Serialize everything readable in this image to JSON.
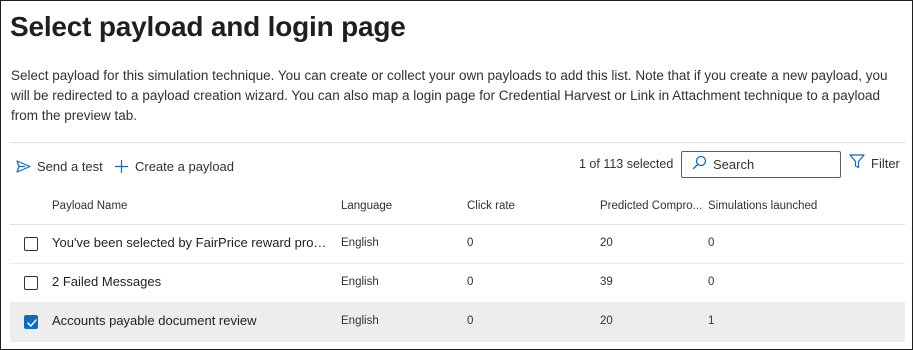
{
  "page": {
    "title": "Select payload and login page",
    "description": "Select payload for this simulation technique. You can create or collect your own payloads to add this list. Note that if you create a new payload, you will be redirected to a payload creation wizard. You can also map a login page for Credential Harvest or Link in Attachment technique to a payload from the preview tab."
  },
  "toolbar": {
    "send_test_label": "Send a test",
    "create_payload_label": "Create a payload",
    "selection_count": "1 of 113 selected",
    "search_placeholder": "Search",
    "search_value": "",
    "filter_label": "Filter"
  },
  "table": {
    "columns": {
      "name": "Payload Name",
      "language": "Language",
      "click_rate": "Click rate",
      "predicted": "Predicted Compro...",
      "simulations": "Simulations launched"
    },
    "rows": [
      {
        "name": "You've been selected by FairPrice reward progr...",
        "language": "English",
        "click_rate": "0",
        "predicted": "20",
        "simulations": "0",
        "selected": false
      },
      {
        "name": "2 Failed Messages",
        "language": "English",
        "click_rate": "0",
        "predicted": "39",
        "simulations": "0",
        "selected": false
      },
      {
        "name": "Accounts payable document review",
        "language": "English",
        "click_rate": "0",
        "predicted": "20",
        "simulations": "1",
        "selected": true
      }
    ]
  },
  "colors": {
    "accent": "#0f6cbd",
    "selected_row_bg": "#ededed",
    "divider": "#e1dfdd"
  },
  "icons": {
    "send_test": "send-icon",
    "create_payload": "plus-icon",
    "search": "search-icon",
    "filter": "filter-icon",
    "checked": "checkmark-icon"
  }
}
